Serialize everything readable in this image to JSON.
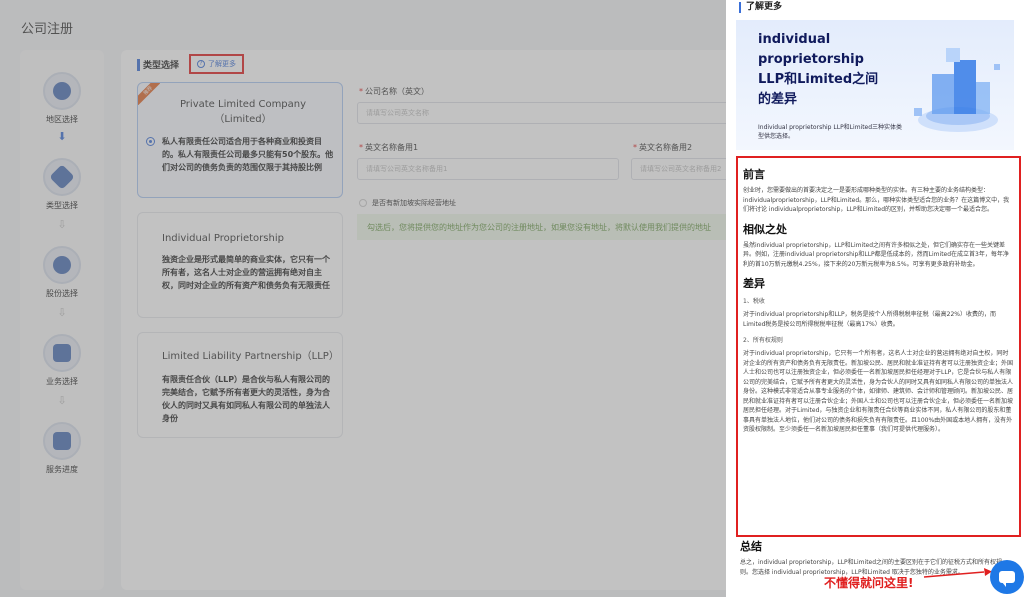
{
  "page": {
    "title": "公司注册"
  },
  "steps": [
    {
      "label": "地区选择",
      "active": true
    },
    {
      "label": "类型选择",
      "active": true
    },
    {
      "label": "股份选择",
      "active": false
    },
    {
      "label": "业务选择",
      "active": false
    },
    {
      "label": "服务进度",
      "active": false
    }
  ],
  "main": {
    "section_title": "类型选择",
    "learn_more": "了解更多",
    "types": [
      {
        "tag": "推荐",
        "name": "Private Limited Company（Limited）",
        "desc": "私人有限责任公司适合用于各种商业和投资目的。私人有限责任公司最多只能有50个股东。他们对公司的债务负责的范围仅限于其持股比例",
        "selected": true
      },
      {
        "name": "Individual Proprietorship",
        "desc": "独资企业是形式最简单的商业实体，它只有一个所有者，这名人士对企业的营运拥有绝对自主权，同时对企业的所有资产和债务负有无限责任",
        "selected": false
      },
      {
        "name": "Limited Liability Partnership（LLP）",
        "desc": "有限责任合伙（LLP）是合伙与私人有限公司的完美结合，它赋予所有者更大的灵活性，身为合伙人的同时又具有如同私人有限公司的单独法人身份",
        "selected": false
      }
    ],
    "fields": {
      "company_name_label": "公司名称（英文）",
      "company_name_placeholder": "请填写公司英文名称",
      "alt1_label": "英文名称备用1",
      "alt1_placeholder": "请填写公司英文名称备用1",
      "alt2_label": "英文名称备用2",
      "alt2_placeholder": "请填写公司英文名称备用2"
    },
    "checkbox_label": "是否有新加坡实际经营地址",
    "notice": "勾选后，您将提供您的地址作为您公司的注册地址，如果您没有地址，将默认使用我们提供的地址"
  },
  "drawer": {
    "heading": "了解更多",
    "banner_title": "individual proprietorship LLP和Limited之间的差异",
    "banner_subtitle": "Individual proprietorship LLP和Limited三种实体类型供您选择。",
    "sections": [
      {
        "heading": "前言",
        "paragraphs": [
          "创业时，您需要做出的首要决定之一是要形成哪种类型的实体。有三种主要的业务结构类型：individualproprietorship，LLP和Limited。那么，哪种实体类型适合您的业务？在这篇博文中，我们将讨论 individualproprietorship，LLP和Limited的区别，并帮助您决定哪一个最适合您。"
        ]
      },
      {
        "heading": "相似之处",
        "paragraphs": [
          "虽然individual proprietorship，LLP和Limited之间有许多相似之处，但它们确实存在一些关键差异。例如，注册individual proprietorship和LLP都是低成本的，然而Limited在成立首3年，每年净利的首10万新元缴税4.25%，接下来的20万新元税率为8.5%。可享有更多政府补助金。"
        ]
      },
      {
        "heading": "差异",
        "items": [
          {
            "sub": "1、税收",
            "text": "对于individual proprietorship和LLP，税务是按个人所得税税率征税（最高22%）收费的，而Limited税务是按公司所得税税率征税（最高17%）收费。"
          },
          {
            "sub": "2、所有权规则",
            "text": "对于individual proprietorship，它只有一个所有者，这名人士对企业的营运拥有绝对自主权，同时对企业的所有资产和债务负有无限责任。新加坡公民、居民和就业准证持有者可以注册独资企业；外国人士和公司也可以注册独资企业，但必须委任一名新加坡居民担任经理对于LLP，它是合伙与私人有限公司的完美结合，它赋予所有者更大的灵活性，身为合伙人的同时又具有如同私人有限公司的单独法人身份。这种模式非常适合从事专业服务的个体，如律师、建筑师、会计师和管理顾问。新加坡公民、居民和就业准证持有者可以注册合伙企业；外国人士和公司也可以注册合伙企业，但必须委任一名新加坡居民担任经理。对于Limited，与独资企业和有限责任合伙等商业实体不同，私人有限公司的股东和董事具有单独法人地位，他们对公司的债务和损失负有有限责任。且100%由外国或本地人拥有，没有外资股权限制。至少须委任一名新加坡居民担任董事（我们可提供代理服务）。"
          }
        ]
      }
    ],
    "summary_heading": "总结",
    "summary_text": "总之，individual proprietorship，LLP和Limited之间的主要区别在于它们的征税方式和所有权规则。您选择 individual proprietorship，LLP和Limited 取决于您独特的业务需求。",
    "hint": "不懂得就问这里!"
  },
  "colors": {
    "accent": "#3a6fd8",
    "highlight": "#e02020",
    "chat": "#1e78e6"
  }
}
